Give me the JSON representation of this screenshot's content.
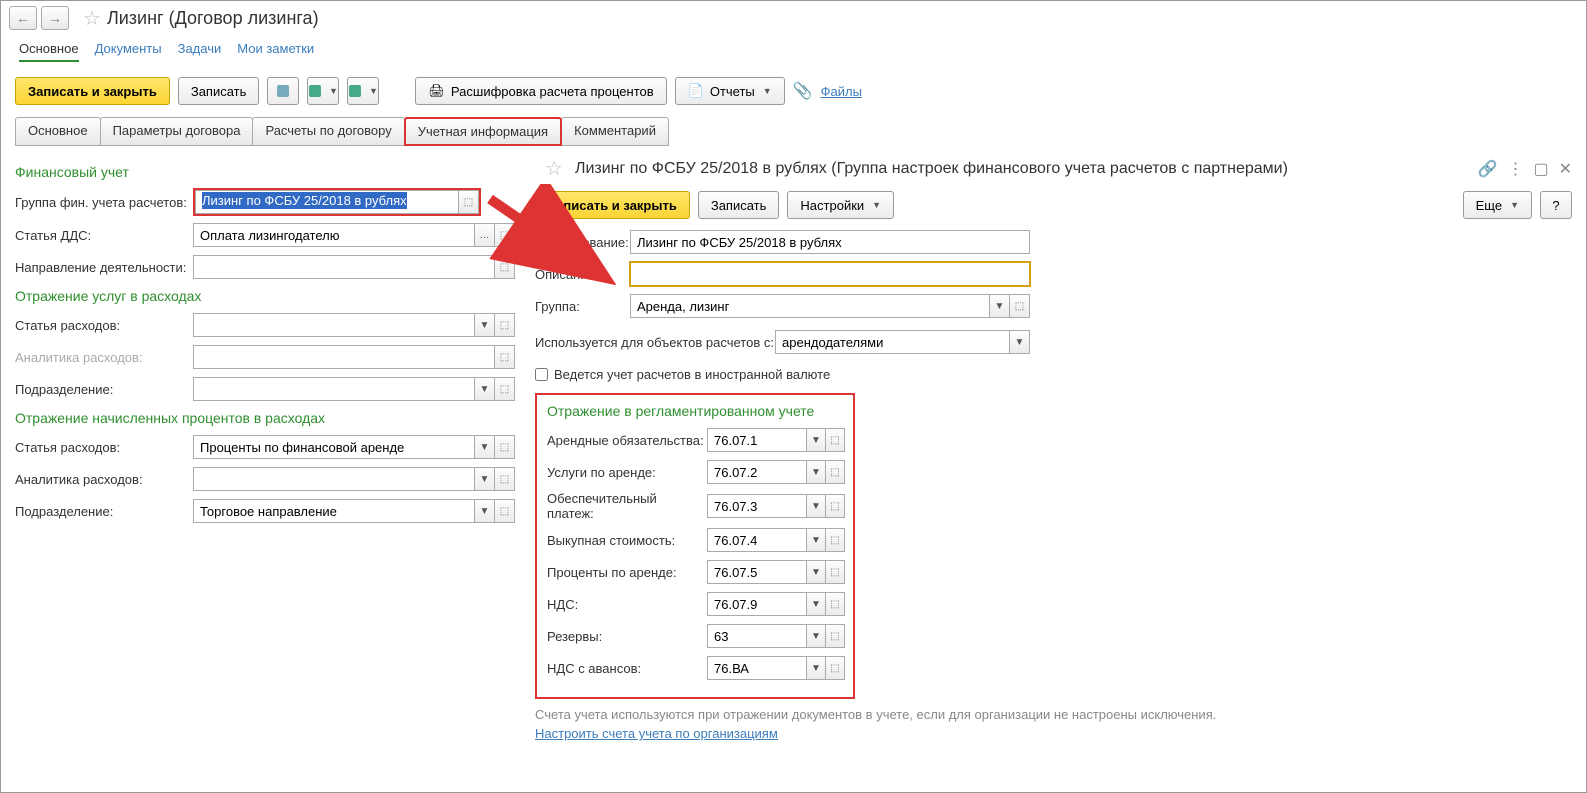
{
  "header": {
    "title": "Лизинг (Договор лизинга)"
  },
  "nav": {
    "main": "Основное",
    "docs": "Документы",
    "tasks": "Задачи",
    "notes": "Мои заметки"
  },
  "toolbar": {
    "save_close": "Записать и закрыть",
    "save": "Записать",
    "interest": "Расшифровка расчета процентов",
    "reports": "Отчеты",
    "files": "Файлы"
  },
  "formTabs": {
    "main": "Основное",
    "params": "Параметры договора",
    "calc": "Расчеты по договору",
    "accounting": "Учетная информация",
    "comment": "Комментарий"
  },
  "left": {
    "finance_head": "Финансовый учет",
    "group_label": "Группа фин. учета расчетов:",
    "group_value": "Лизинг по ФСБУ 25/2018 в рублях",
    "dds_label": "Статья ДДС:",
    "dds_value": "Оплата лизингодателю",
    "direction_label": "Направление деятельности:",
    "services_head": "Отражение услуг в расходах",
    "exp_label": "Статья расходов:",
    "analytics_label": "Аналитика расходов:",
    "division_label": "Подразделение:",
    "interest_head": "Отражение начисленных процентов в расходах",
    "int_exp_value": "Проценты по финансовой аренде",
    "int_div_value": "Торговое направление"
  },
  "right": {
    "title": "Лизинг по ФСБУ 25/2018 в рублях (Группа настроек финансового учета расчетов с партнерами)",
    "save_close": "Записать и закрыть",
    "save": "Записать",
    "settings": "Настройки",
    "more": "Еще",
    "name_label": "Наименование:",
    "name_value": "Лизинг по ФСБУ 25/2018 в рублях",
    "desc_label": "Описание:",
    "group_label": "Группа:",
    "group_value": "Аренда, лизинг",
    "used_label": "Используется для объектов расчетов с:",
    "used_value": "арендодателями",
    "currency_check": "Ведется учет расчетов в иностранной валюте",
    "reg_head": "Отражение в регламентированном учете",
    "accounts": [
      {
        "label": "Арендные обязательства:",
        "value": "76.07.1"
      },
      {
        "label": "Услуги по аренде:",
        "value": "76.07.2"
      },
      {
        "label": "Обеспечительный платеж:",
        "value": "76.07.3"
      },
      {
        "label": "Выкупная стоимость:",
        "value": "76.07.4"
      },
      {
        "label": "Проценты по аренде:",
        "value": "76.07.5"
      },
      {
        "label": "НДС:",
        "value": "76.07.9"
      },
      {
        "label": "Резервы:",
        "value": "63"
      },
      {
        "label": "НДС с авансов:",
        "value": "76.ВА"
      }
    ],
    "hint": "Счета учета используются при отражении документов в учете, если для организации не настроены исключения.",
    "hint_link": "Настроить счета учета по организациям"
  }
}
